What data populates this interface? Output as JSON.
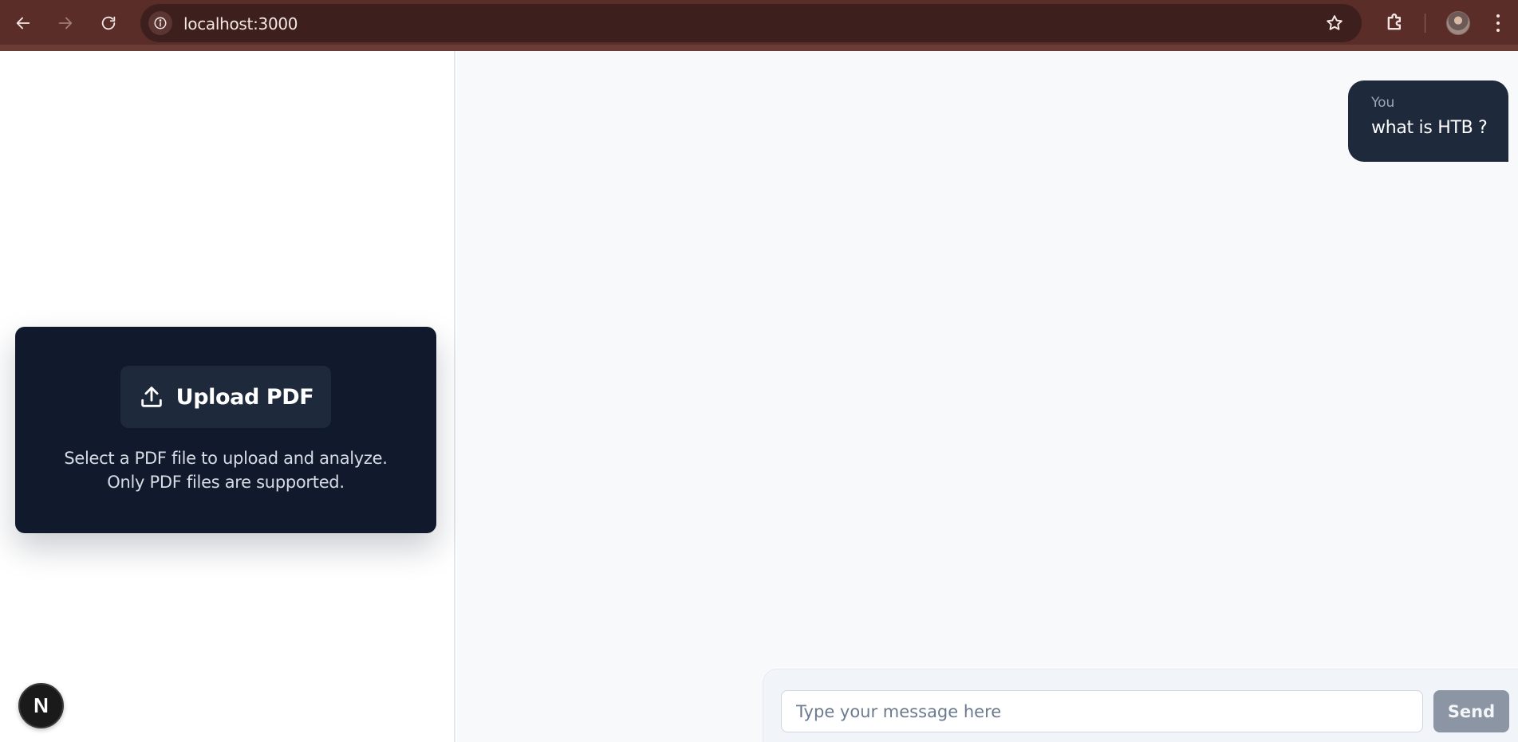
{
  "browser": {
    "url": "localhost:3000",
    "back_icon": "arrow-left-icon",
    "forward_icon": "arrow-right-icon",
    "reload_icon": "reload-icon",
    "site_info_icon": "info-icon",
    "bookmark_icon": "star-icon",
    "extensions_icon": "puzzle-icon",
    "profile_icon": "avatar",
    "menu_icon": "kebab-menu-icon"
  },
  "sidebar": {
    "upload": {
      "button_label": "Upload PDF",
      "icon": "upload-icon",
      "description": "Select a PDF file to upload and analyze. Only PDF files are supported."
    },
    "badge_letter": "N"
  },
  "chat": {
    "messages": [
      {
        "sender": "You",
        "text": "what is HTB ?"
      }
    ],
    "composer": {
      "placeholder": "Type your message here",
      "value": "",
      "send_label": "Send"
    }
  },
  "colors": {
    "chrome_bg": "#5a2d28",
    "omnibox_bg": "#3d1f1d",
    "card_bg": "#111a2c",
    "bubble_bg": "#1e293b",
    "chat_bg": "#f8f9fb",
    "send_bg": "#8b95a3"
  }
}
